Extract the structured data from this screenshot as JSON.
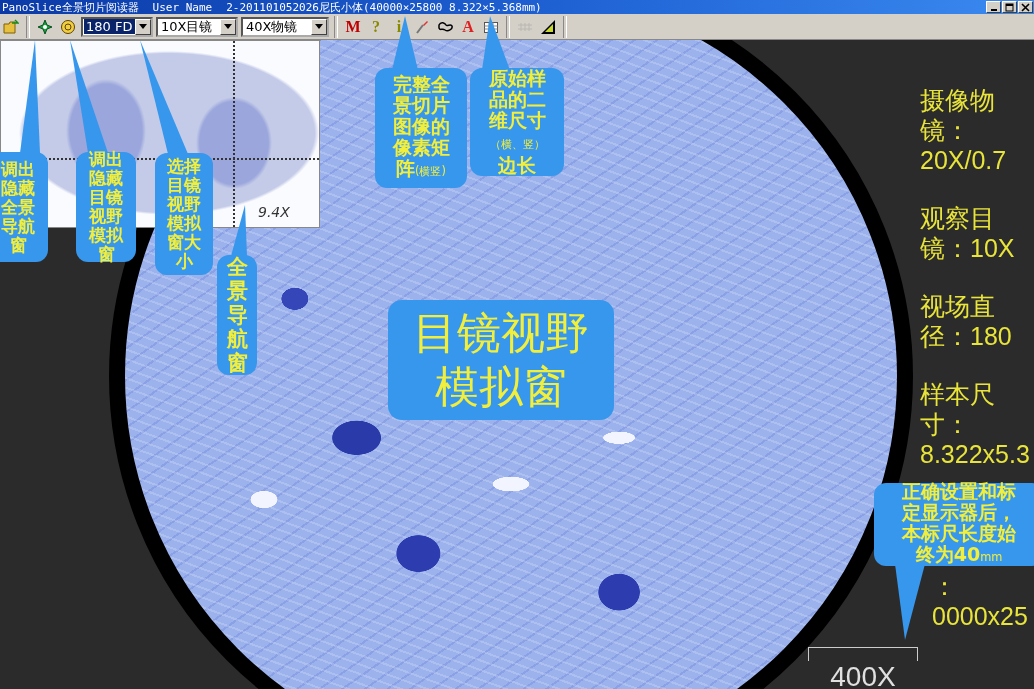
{
  "window": {
    "title": "PanoSlice全景切片阅读器",
    "user": "User Name",
    "file": "2-201101052026尼氏小体(40000×25800 8.322×5.368mm)"
  },
  "toolbar": {
    "dropdowns": [
      {
        "value": "180 FD",
        "focused": true
      },
      {
        "value": "10X目镜",
        "focused": false
      },
      {
        "value": "40X物镜",
        "focused": false
      }
    ],
    "tools": [
      {
        "kind": "letter",
        "label": "M",
        "disabled": false
      },
      {
        "kind": "letter",
        "label": "?",
        "disabled": false
      },
      {
        "kind": "letter",
        "label": "i",
        "disabled": false
      },
      {
        "kind": "icon",
        "disabled": false
      },
      {
        "kind": "icon",
        "disabled": false
      },
      {
        "kind": "letter",
        "label": "A",
        "disabled": false
      },
      {
        "kind": "icon",
        "disabled": false
      },
      {
        "kind": "icon",
        "disabled": true
      },
      {
        "kind": "icon",
        "disabled": false
      }
    ]
  },
  "navigator": {
    "zoom": "9.4X"
  },
  "info": [
    {
      "label": "摄像物镜：",
      "value": "20X/0.7"
    },
    {
      "label": "观察目镜：",
      "value": "10X"
    },
    {
      "label": "视场直径：",
      "value": "180"
    },
    {
      "label": "样本尺寸：",
      "value": "8.322x5.3"
    },
    {
      "label": "：",
      "value": "0000x25"
    }
  ],
  "scale_bar": {
    "label": "400X"
  },
  "annotation_title": "目镜视野模拟窗",
  "callouts": [
    {
      "parts": [
        {
          "kind": "main",
          "text": "调出隐藏全景导航窗"
        }
      ]
    },
    {
      "parts": [
        {
          "kind": "main",
          "text": "调出隐藏目镜视野模拟窗"
        }
      ]
    },
    {
      "parts": [
        {
          "kind": "main",
          "text": "选择目镜视野模拟窗大小"
        }
      ]
    },
    {
      "parts": [
        {
          "kind": "main",
          "text": "全景导航窗"
        }
      ]
    },
    {
      "parts": [
        {
          "kind": "main",
          "text": "完整全景切片图像的像素矩阵"
        },
        {
          "kind": "note",
          "text": "(横竖)"
        }
      ]
    },
    {
      "parts": [
        {
          "kind": "main",
          "text": "原始样品的二维尺寸"
        },
        {
          "kind": "note",
          "text": "（横、竖）"
        },
        {
          "kind": "main",
          "text": "边长"
        }
      ]
    },
    {
      "parts": [
        {
          "kind": "main",
          "text": "正确设置和标定显示器后，本标尺长度始终为40"
        },
        {
          "kind": "note",
          "text": "mm"
        }
      ]
    }
  ]
}
